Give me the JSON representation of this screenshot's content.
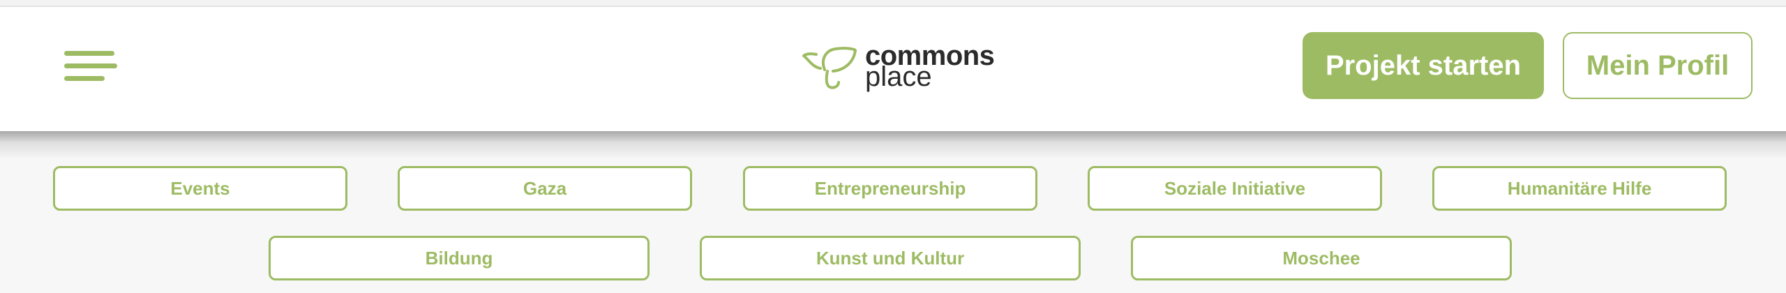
{
  "colors": {
    "accent": "#9dbb63",
    "text_dark": "#2b2b2b"
  },
  "header": {
    "menu_icon": "hamburger-menu-icon",
    "logo": {
      "icon": "sprout-leaf-icon",
      "word1": "commons",
      "word2": "place"
    },
    "primary_button": "Projekt starten",
    "profile_button": "Mein Profil"
  },
  "categories": {
    "row1": [
      "Events",
      "Gaza",
      "Entrepreneurship",
      "Soziale Initiative",
      "Humanitäre Hilfe"
    ],
    "row2": [
      "Bildung",
      "Kunst und Kultur",
      "Moschee"
    ]
  }
}
